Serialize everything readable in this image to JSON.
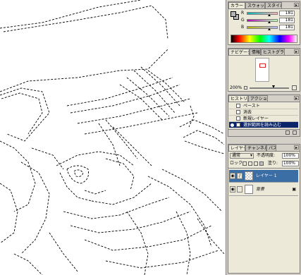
{
  "color_panel": {
    "tabs": [
      "カラー",
      "スウォッチ",
      "スタイル"
    ],
    "sliders": [
      {
        "label": "R",
        "value": "181",
        "color": "#d04040"
      },
      {
        "label": "G",
        "value": "181",
        "color": "#40b040"
      },
      {
        "label": "B",
        "value": "181",
        "color": "#4040d0"
      }
    ]
  },
  "navigator_panel": {
    "tabs": [
      "ナビゲータ",
      "情報",
      "ヒストグラム"
    ],
    "zoom": "200%"
  },
  "history_panel": {
    "tabs": [
      "ヒストリー",
      "アクション"
    ],
    "items": [
      {
        "label": "ペースト",
        "selected": false
      },
      {
        "label": "消去",
        "selected": false
      },
      {
        "label": "新規レイヤー",
        "selected": false
      },
      {
        "label": "選択範囲を読み込む",
        "selected": true
      }
    ]
  },
  "layers_panel": {
    "tabs": [
      "レイヤー",
      "チャンネル",
      "パス"
    ],
    "blend_mode": "通常",
    "opacity_label": "不透明度:",
    "opacity_value": "100%",
    "lock_label": "ロック:",
    "fill_label": "塗り:",
    "fill_value": "100%",
    "layers": [
      {
        "name": "レイヤー 1",
        "selected": true
      },
      {
        "name": "背景",
        "selected": false
      }
    ]
  },
  "icons": [
    "eye-icon",
    "brush-icon",
    "lock-icon",
    "panel-menu-icon"
  ]
}
